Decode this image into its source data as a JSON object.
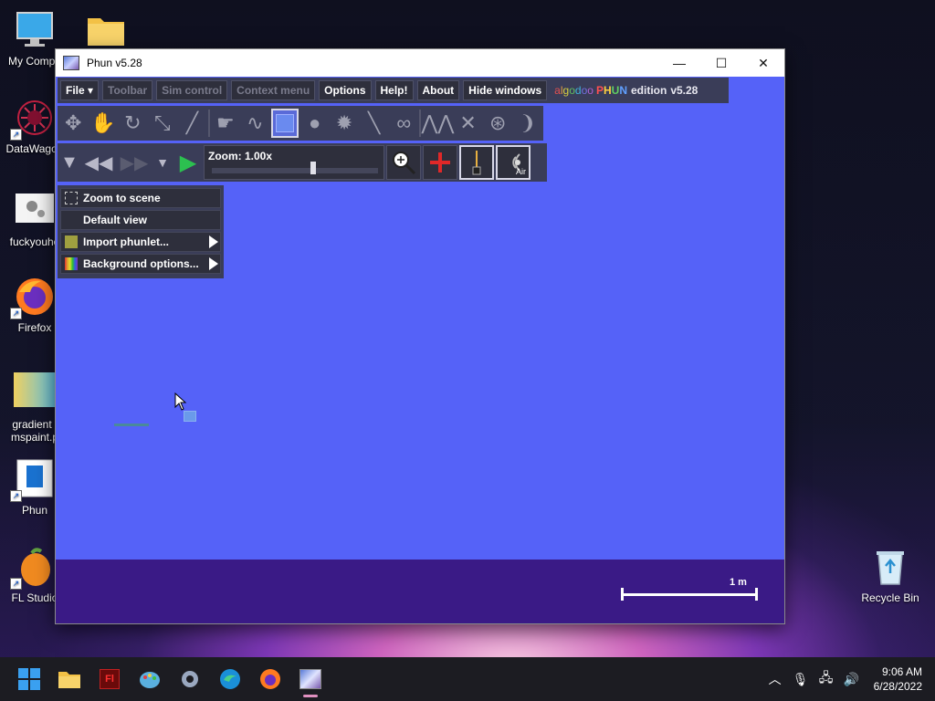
{
  "desktop": {
    "icons": [
      {
        "label": "My Compu",
        "icon": "monitor-icon"
      },
      {
        "label": "",
        "icon": "folder-icon"
      },
      {
        "label": "DataWagon",
        "icon": "datawagon-icon"
      },
      {
        "label": "fuckyouhe",
        "icon": "settings-file-icon"
      },
      {
        "label": "Firefox",
        "icon": "firefox-icon"
      },
      {
        "label": "gradient i",
        "label2": "mspaint.p",
        "icon": "gradient-image-icon"
      },
      {
        "label": "Phun",
        "icon": "phun-shortcut-icon"
      },
      {
        "label": "FL Studio",
        "icon": "fl-studio-icon"
      },
      {
        "label": "Recycle Bin",
        "icon": "recycle-bin-icon"
      }
    ]
  },
  "window": {
    "title": "Phun v5.28",
    "controls": {
      "minimize": "—",
      "maximize": "☐",
      "close": "✕"
    }
  },
  "menubar": {
    "items": [
      {
        "label": "File ▾",
        "enabled": true
      },
      {
        "label": "Toolbar",
        "enabled": false
      },
      {
        "label": "Sim control",
        "enabled": false
      },
      {
        "label": "Context menu",
        "enabled": false
      },
      {
        "label": "Options",
        "enabled": true
      },
      {
        "label": "Help!",
        "enabled": true
      },
      {
        "label": "About",
        "enabled": true
      },
      {
        "label": "Hide windows",
        "enabled": true
      }
    ],
    "brand": {
      "algodoo": "algodoo",
      "phun": "PHUN",
      "edition": "edition",
      "version": "v5.28"
    }
  },
  "toolbar": {
    "tools": [
      "move-tool-icon",
      "hand-tool-icon",
      "rotate-tool-icon",
      "scale-tool-icon",
      "knife-tool-icon",
      "grab-tool-icon",
      "brush-tool-icon",
      "box-tool-icon",
      "circle-tool-icon",
      "gear-tool-icon",
      "plane-tool-icon",
      "chain-tool-icon",
      "spring-tool-icon",
      "fixate-tool-icon",
      "hinge-tool-icon",
      "tracer-tool-icon"
    ],
    "selected": "box-tool-icon"
  },
  "simbar": {
    "zoom_label": "Zoom: 1.00x",
    "zoom_level": 0.64,
    "air_label": "Air"
  },
  "context_menu": {
    "items": [
      {
        "label": "Zoom to scene",
        "icon": "zoom-scene-icon",
        "submenu": false
      },
      {
        "label": "Default view",
        "icon": "",
        "submenu": false
      },
      {
        "label": "Import phunlet...",
        "icon": "import-icon",
        "submenu": true
      },
      {
        "label": "Background options...",
        "icon": "rainbow-icon",
        "submenu": true
      }
    ]
  },
  "scale": {
    "label": "1 m"
  },
  "taskbar": {
    "apps": [
      "windows-start-icon",
      "file-explorer-icon",
      "flash-icon",
      "paint-icon",
      "settings-icon",
      "edge-icon",
      "firefox-icon",
      "phun-icon"
    ],
    "active": "phun-icon",
    "tray": {
      "time": "9:06 AM",
      "date": "6/28/2022"
    }
  },
  "colors": {
    "canvas": "#5562f8",
    "ground": "#3a1a86",
    "panel": "#3a3d58"
  }
}
